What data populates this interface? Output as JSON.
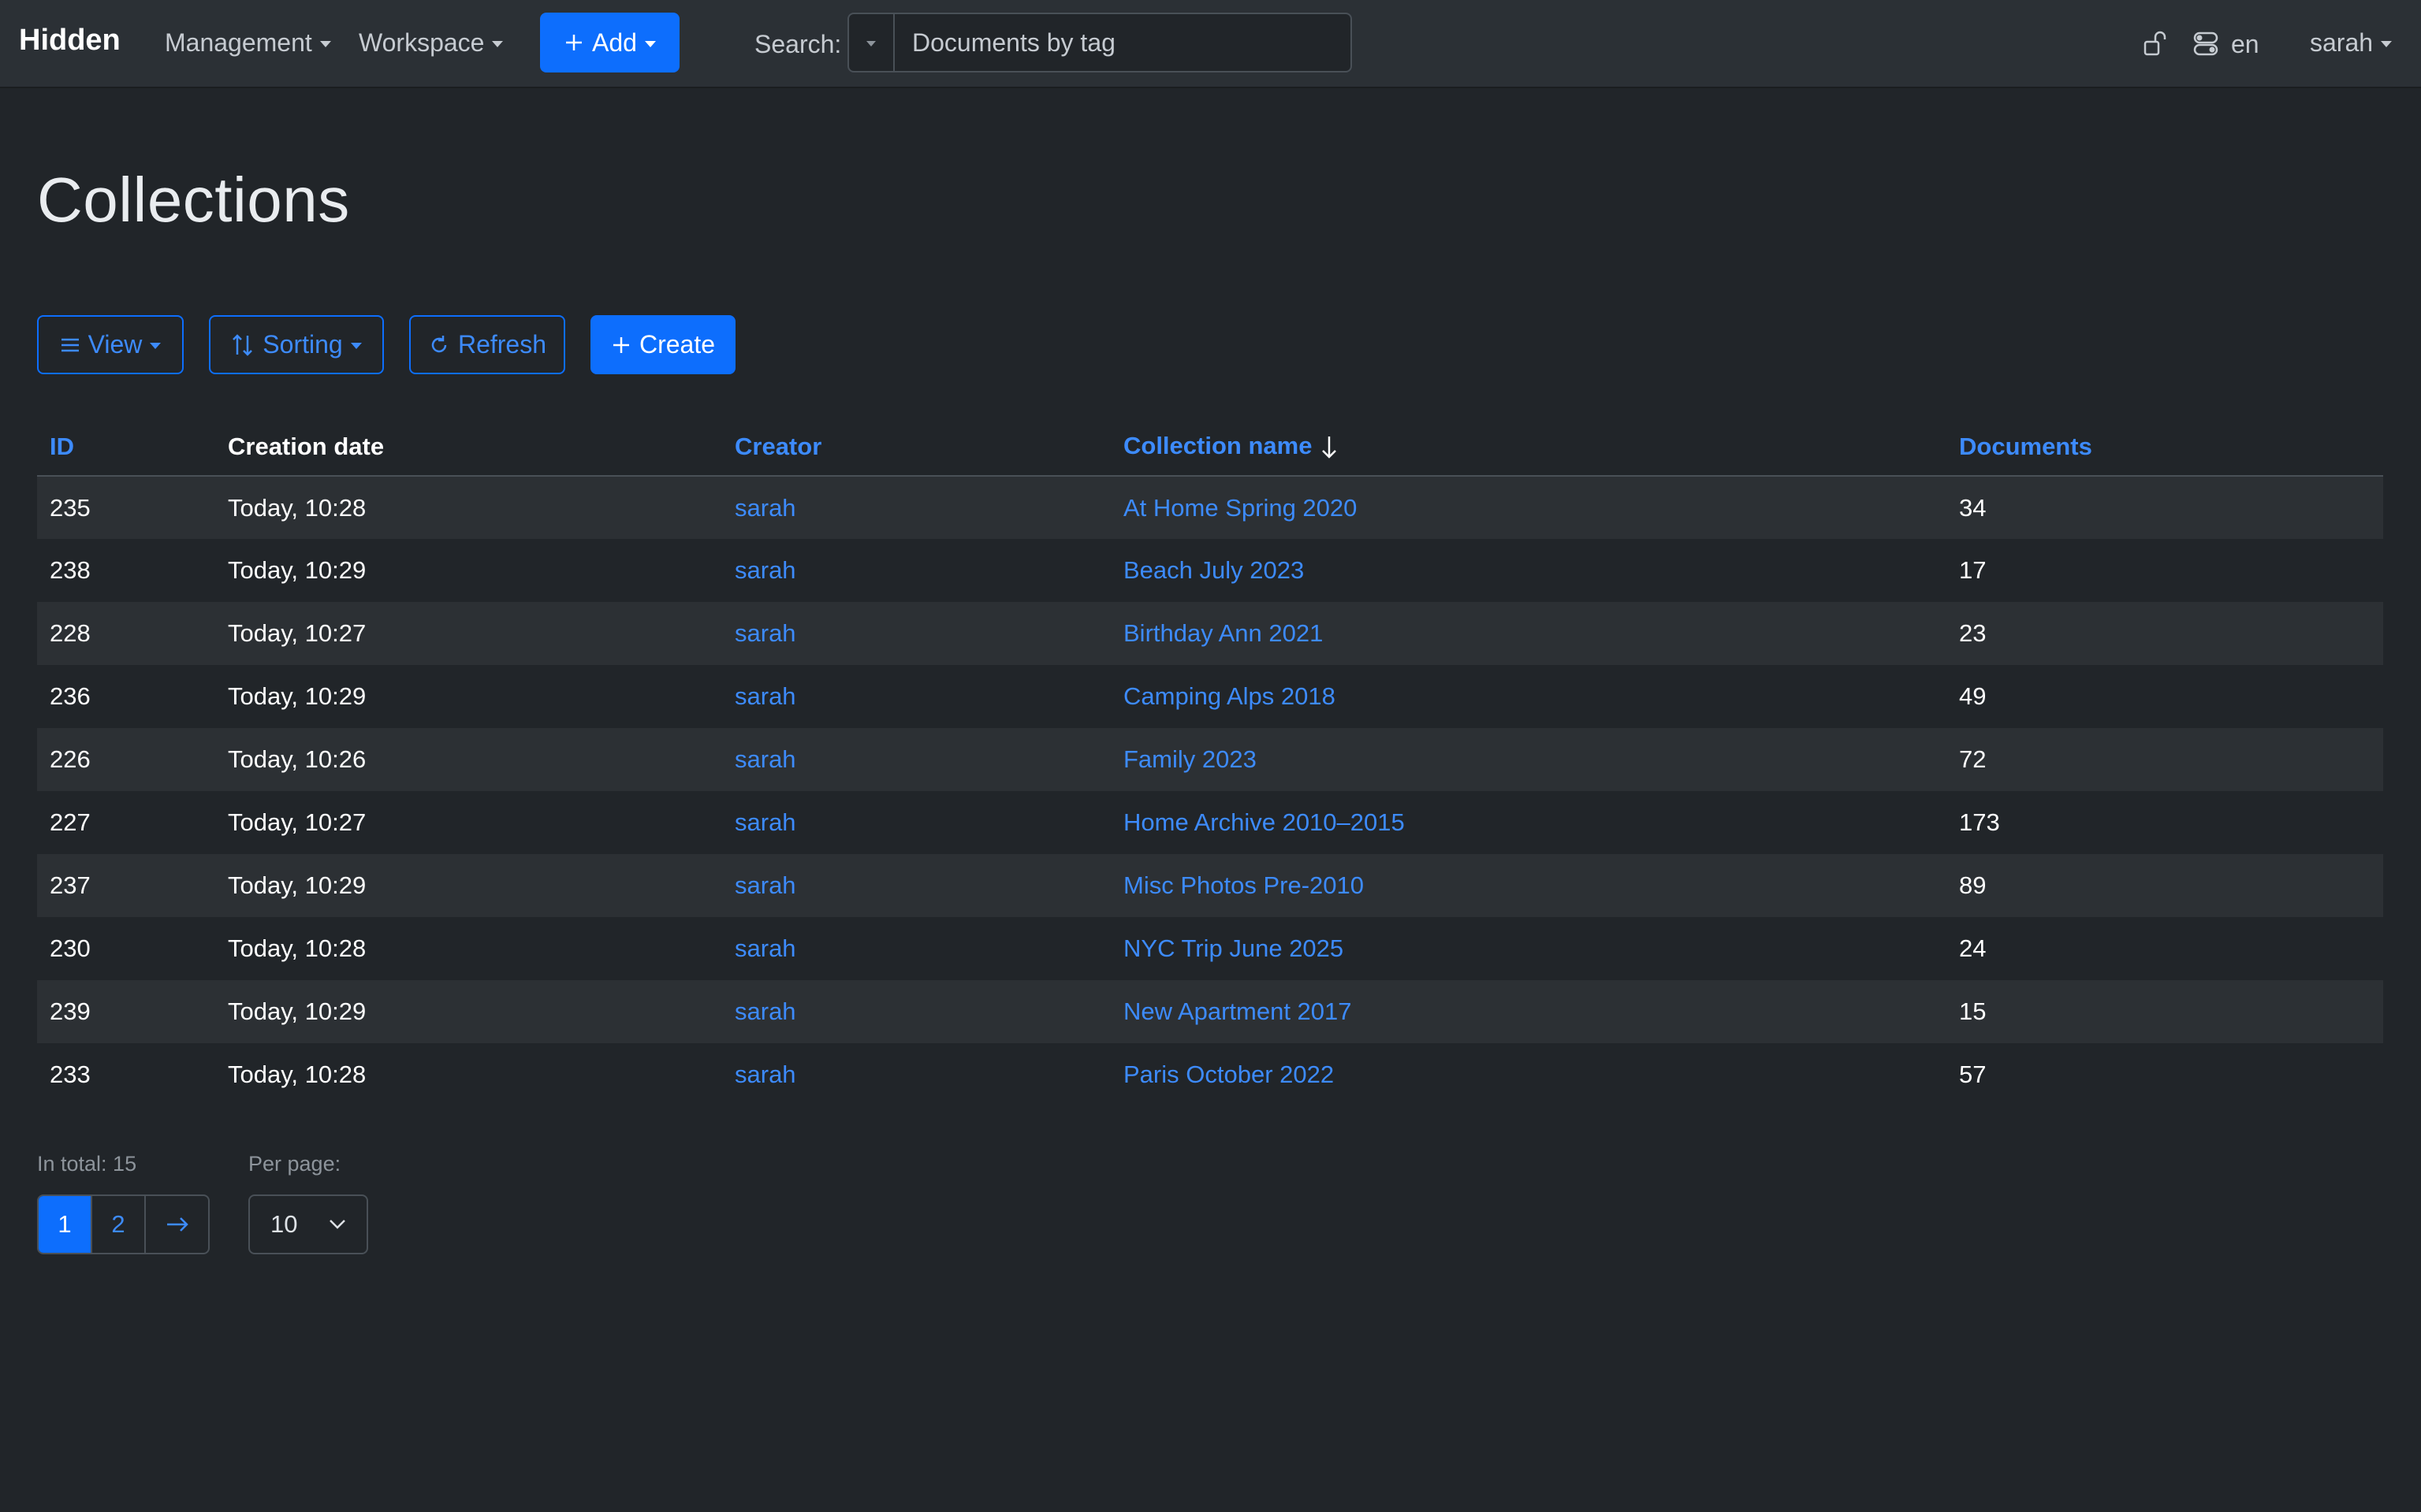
{
  "navbar": {
    "brand": "Hidden",
    "menus": [
      {
        "label": "Management"
      },
      {
        "label": "Workspace"
      }
    ],
    "add_label": "Add",
    "search_label": "Search:",
    "search_placeholder": "Documents by tag",
    "language": "en",
    "user": "sarah"
  },
  "page": {
    "title": "Collections"
  },
  "toolbar": {
    "view_label": "View",
    "sorting_label": "Sorting",
    "refresh_label": "Refresh",
    "create_label": "Create"
  },
  "table": {
    "columns": [
      {
        "label": "ID"
      },
      {
        "label": "Creation date"
      },
      {
        "label": "Creator"
      },
      {
        "label": "Collection name"
      },
      {
        "label": "Documents"
      }
    ],
    "rows": [
      {
        "id": "235",
        "date": "Today, 10:28",
        "creator": "sarah",
        "name": "At Home Spring 2020",
        "docs": "34"
      },
      {
        "id": "238",
        "date": "Today, 10:29",
        "creator": "sarah",
        "name": "Beach July 2023",
        "docs": "17"
      },
      {
        "id": "228",
        "date": "Today, 10:27",
        "creator": "sarah",
        "name": "Birthday Ann 2021",
        "docs": "23"
      },
      {
        "id": "236",
        "date": "Today, 10:29",
        "creator": "sarah",
        "name": "Camping Alps 2018",
        "docs": "49"
      },
      {
        "id": "226",
        "date": "Today, 10:26",
        "creator": "sarah",
        "name": "Family 2023",
        "docs": "72"
      },
      {
        "id": "227",
        "date": "Today, 10:27",
        "creator": "sarah",
        "name": "Home Archive 2010–2015",
        "docs": "173"
      },
      {
        "id": "237",
        "date": "Today, 10:29",
        "creator": "sarah",
        "name": "Misc Photos Pre-2010",
        "docs": "89"
      },
      {
        "id": "230",
        "date": "Today, 10:28",
        "creator": "sarah",
        "name": "NYC Trip June 2025",
        "docs": "24"
      },
      {
        "id": "239",
        "date": "Today, 10:29",
        "creator": "sarah",
        "name": "New Apartment 2017",
        "docs": "15"
      },
      {
        "id": "233",
        "date": "Today, 10:28",
        "creator": "sarah",
        "name": "Paris October 2022",
        "docs": "57"
      }
    ]
  },
  "footer": {
    "total_label": "In total: 15",
    "per_page_label": "Per page:",
    "pages": [
      "1",
      "2"
    ],
    "current_page": "1",
    "per_page_value": "10"
  },
  "colors": {
    "background": "#212529",
    "navbar": "#2b3035",
    "accent": "#0d6efd",
    "link": "#3d8bfd",
    "stripe": "#2c3034"
  }
}
